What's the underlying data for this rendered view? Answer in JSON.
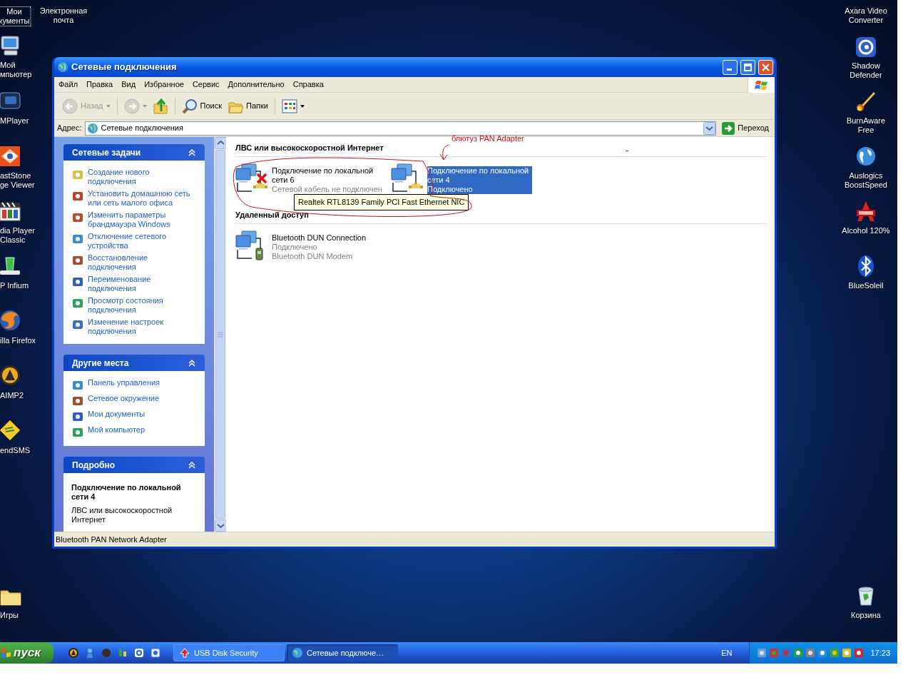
{
  "desktop": {
    "icons": [
      {
        "lines": [
          "Мои",
          "кументы"
        ],
        "focused": true
      },
      {
        "lines": [
          "Электронная",
          "почта"
        ],
        "focused": false
      },
      {
        "lines": [
          "Мой",
          "мпьютер"
        ],
        "focused": false
      },
      {
        "lines": [
          "MPlayer"
        ],
        "focused": false
      },
      {
        "lines": [
          "astStone",
          "ge Viewer"
        ],
        "focused": false
      },
      {
        "lines": [
          "dia Player",
          "Classic"
        ],
        "focused": false
      },
      {
        "lines": [
          "P Infium"
        ],
        "focused": false
      },
      {
        "lines": [
          "illa Firefox"
        ],
        "focused": false
      },
      {
        "lines": [
          "AIMP2"
        ],
        "focused": false
      },
      {
        "lines": [
          "endSMS"
        ],
        "focused": false
      },
      {
        "lines": [
          "Игры"
        ],
        "focused": false
      },
      {
        "lines": [
          "Axara Video",
          "Converter"
        ],
        "focused": false
      },
      {
        "lines": [
          "Shadow",
          "Defender"
        ],
        "focused": false
      },
      {
        "lines": [
          "BurnAware",
          "Free"
        ],
        "focused": false
      },
      {
        "lines": [
          "Auslogics",
          "BoostSpeed"
        ],
        "focused": false
      },
      {
        "lines": [
          "Alcohol 120%"
        ],
        "focused": false
      },
      {
        "lines": [
          "BlueSoleil"
        ],
        "focused": false
      },
      {
        "lines": [
          "Корзина"
        ],
        "focused": false
      }
    ]
  },
  "window": {
    "title": "Сетевые подключения",
    "menu": [
      "Файл",
      "Правка",
      "Вид",
      "Избранное",
      "Сервис",
      "Дополнительно",
      "Справка"
    ],
    "toolbar": [
      {
        "kind": "back",
        "label": "Назад",
        "disabled": true
      },
      {
        "kind": "forward",
        "disabled": true
      },
      {
        "kind": "up",
        "disabled": false
      },
      {
        "kind": "search",
        "label": "Поиск",
        "disabled": false
      },
      {
        "kind": "folders",
        "label": "Папки",
        "disabled": false
      },
      {
        "kind": "views",
        "disabled": false
      }
    ],
    "address": {
      "label": "Адрес:",
      "value": "Сетевые подключения",
      "go": "Переход"
    },
    "task_panels": [
      {
        "title": "Сетевые задачи",
        "expanded": true,
        "items": [
          "Создание нового подключения",
          "Установить домашнюю сеть или сеть малого офиса",
          "Изменить параметры брандмауэра Windows",
          "Отключение сетевого устройства",
          "Восстановление подключения",
          "Переименование подключения",
          "Просмотр состояния подключения",
          "Изменение настроек подключения"
        ]
      },
      {
        "title": "Другие места",
        "expanded": true,
        "items": [
          "Панель управления",
          "Сетевое окружение",
          "Мои документы",
          "Мой компьютер"
        ]
      }
    ],
    "details": {
      "title": "Подробно",
      "expanded": true,
      "name": "Подключение по локальной сети 4",
      "lines": [
        "ЛВС или высокоскоростной Интернет"
      ]
    },
    "groups": [
      {
        "title": "ЛВС или высокоскоростной Интернет",
        "items": [
          {
            "kind": "lan",
            "name": "Подключение по локальной сети 6",
            "status": "Сетевой кабель не подключен",
            "disconnected": true,
            "selected": false
          },
          {
            "kind": "lan",
            "name": "Подключение по локальной сети 4",
            "status": "Подключено",
            "disconnected": false,
            "selected": true
          }
        ]
      },
      {
        "title": "Удаленный доступ",
        "items": [
          {
            "kind": "modem",
            "name": "Bluetooth DUN Connection",
            "status": "Подключено",
            "device": "Bluetooth DUN Modem",
            "disconnected": false,
            "selected": false
          }
        ]
      }
    ],
    "tooltip": "Realtek RTL8139 Family PCI Fast Ethernet NIC",
    "annotation": "блютуз PAN Adapter",
    "status_bar": "Bluetooth PAN Network Adapter"
  },
  "taskbar": {
    "start": "пуск",
    "tasks": [
      {
        "label": "USB Disk Security",
        "selected": false
      },
      {
        "label": "Сетевые подключе…",
        "selected": true
      }
    ],
    "language": "EN",
    "clock": "17:23"
  }
}
